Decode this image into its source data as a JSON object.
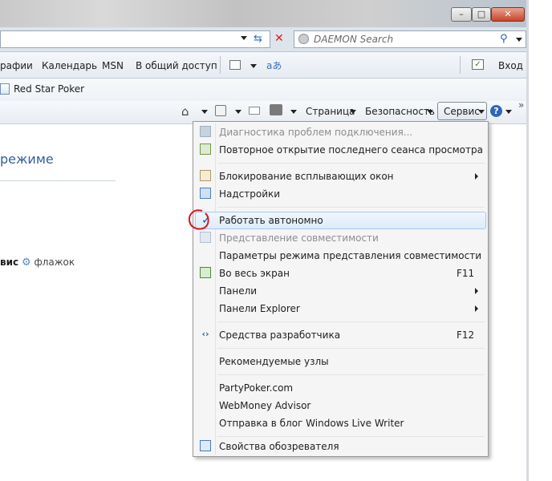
{
  "window": {
    "minimize": "–",
    "maximize": "□",
    "close": "✕"
  },
  "search": {
    "placeholder": "DAEMON Search"
  },
  "favbar": {
    "items": [
      "рафии",
      "Календарь",
      "MSN",
      "В общий доступ"
    ],
    "login": "Вход"
  },
  "links": {
    "item": "Red Star Poker"
  },
  "cmdbar": {
    "page": "Страница",
    "safety": "Безопасность",
    "service": "Сервис",
    "more": "»"
  },
  "page": {
    "title": "режиме",
    "line_bold": "вис",
    "line_rest": "флажок"
  },
  "menu": {
    "items": [
      {
        "label": "Диагностика проблем подключения...",
        "disabled": true,
        "icon": "network-diagnose-icon"
      },
      {
        "label": "Повторное открытие последнего сеанса просмотра",
        "icon": "reopen-session-icon"
      },
      {
        "label": "Блокирование всплывающих окон",
        "submenu": true,
        "icon": "popup-blocker-icon"
      },
      {
        "label": "Надстройки",
        "icon": "addons-icon"
      },
      {
        "label": "Работать автономно",
        "checked": true,
        "highlighted": true,
        "icon": "checkmark-icon"
      },
      {
        "label": "Представление совместимости",
        "disabled": true,
        "icon": "compatibility-icon"
      },
      {
        "label": "Параметры режима представления совместимости"
      },
      {
        "label": "Во весь экран",
        "shortcut": "F11",
        "icon": "fullscreen-icon"
      },
      {
        "label": "Панели",
        "submenu": true
      },
      {
        "label": "Панели Explorer",
        "submenu": true
      },
      {
        "label": "Средства разработчика",
        "shortcut": "F12",
        "icon": "developer-tools-icon"
      },
      {
        "label": "Рекомендуемые узлы"
      },
      {
        "label": "PartyPoker.com"
      },
      {
        "label": "WebMoney Advisor"
      },
      {
        "label": "Отправка в блог Windows Live Writer"
      },
      {
        "label": "Свойства обозревателя",
        "icon": "internet-options-icon"
      }
    ]
  },
  "colors": {
    "accent": "#335f9a",
    "highlight_border": "#a8c8eb",
    "annotation": "#e0141c"
  }
}
